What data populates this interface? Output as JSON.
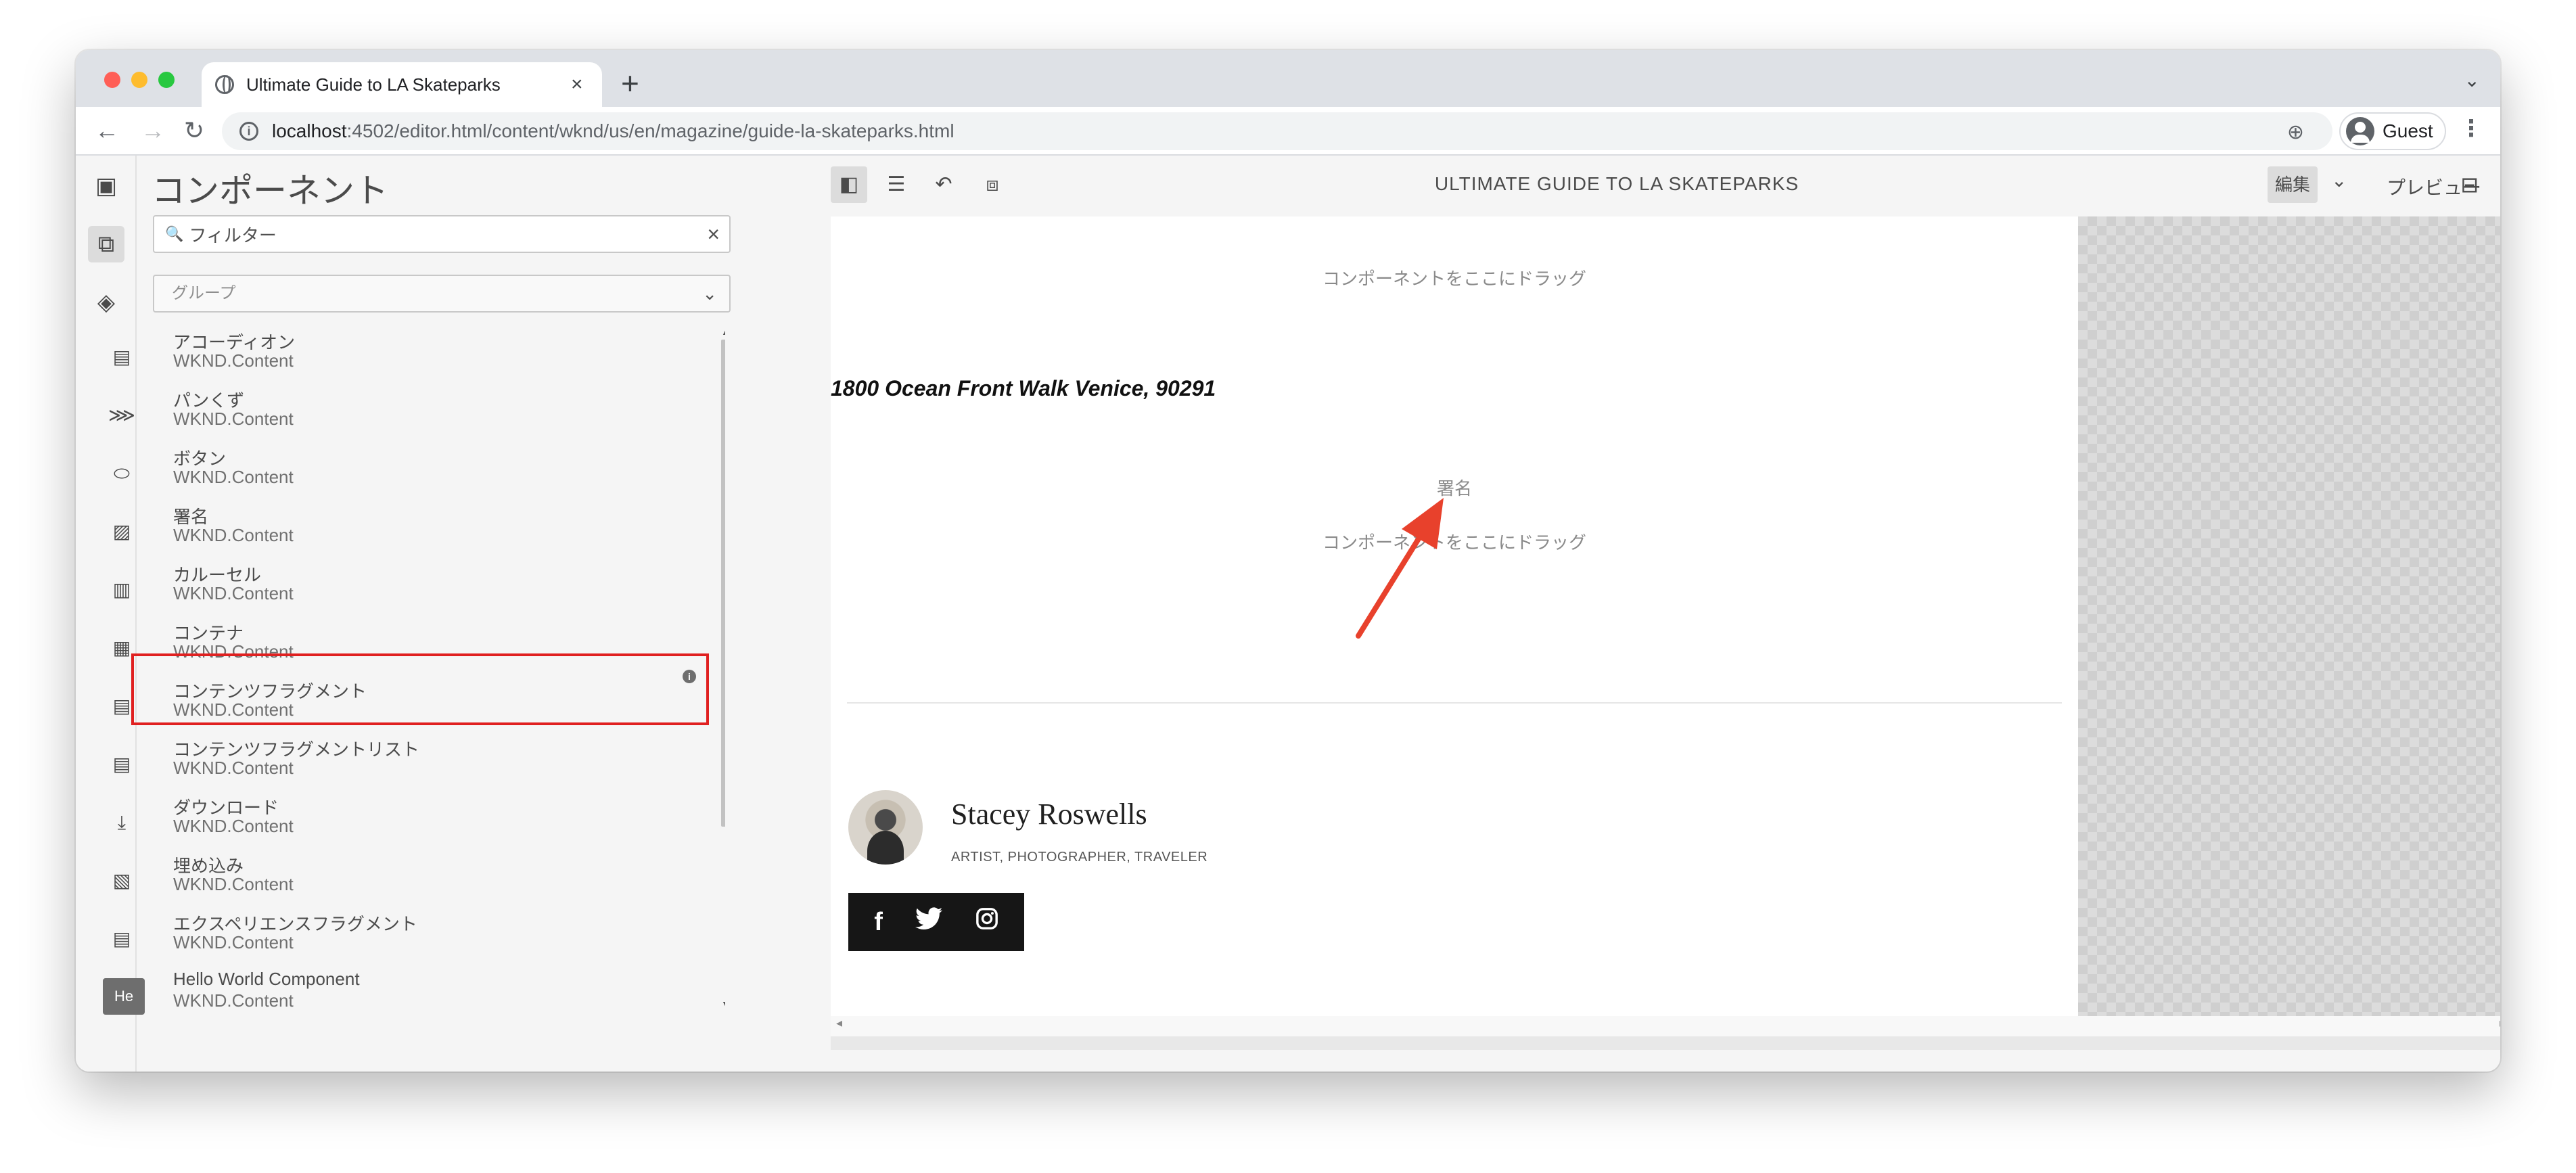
{
  "browser": {
    "tab_title": "Ultimate Guide to LA Skateparks",
    "tab_close": "×",
    "new_tab": "+",
    "url_host": "localhost",
    "url_rest": ":4502/editor.html/content/wknd/us/en/magazine/guide-la-skateparks.html",
    "profile_name": "Guest"
  },
  "panel": {
    "title": "コンポーネント",
    "filter_placeholder": "フィルター",
    "group_placeholder": "グループ",
    "components": [
      {
        "name": "アコーディオン",
        "group": "WKND.Content",
        "icon": "accordion-icon"
      },
      {
        "name": "パンくず",
        "group": "WKND.Content",
        "icon": "breadcrumb-icon"
      },
      {
        "name": "ボタン",
        "group": "WKND.Content",
        "icon": "button-icon"
      },
      {
        "name": "署名",
        "group": "WKND.Content",
        "icon": "image-icon"
      },
      {
        "name": "カルーセル",
        "group": "WKND.Content",
        "icon": "carousel-icon"
      },
      {
        "name": "コンテナ",
        "group": "WKND.Content",
        "icon": "container-icon"
      },
      {
        "name": "コンテンツフラグメント",
        "group": "WKND.Content",
        "icon": "content-fragment-icon"
      },
      {
        "name": "コンテンツフラグメントリスト",
        "group": "WKND.Content",
        "icon": "content-fragment-list-icon"
      },
      {
        "name": "ダウンロード",
        "group": "WKND.Content",
        "icon": "download-icon"
      },
      {
        "name": "埋め込み",
        "group": "WKND.Content",
        "icon": "embed-icon"
      },
      {
        "name": "エクスペリエンスフラグメント",
        "group": "WKND.Content",
        "icon": "experience-fragment-icon"
      },
      {
        "name": "Hello World Component",
        "group": "WKND.Content",
        "icon": "hello-world-badge",
        "badge": "He"
      }
    ]
  },
  "editor": {
    "page_title": "ULTIMATE GUIDE TO LA SKATEPARKS",
    "edit_label": "編集",
    "preview_label": "プレビュー"
  },
  "page": {
    "drop_hint_1": "コンポーネントをここにドラッグ",
    "address": "1800 Ocean Front Walk Venice, 90291",
    "signature_label": "署名",
    "drop_hint_2": "コンポーネントをここにドラッグ",
    "author_name": "Stacey Roswells",
    "author_role": "ARTIST, PHOTOGRAPHER, TRAVELER",
    "social": [
      "f",
      "twitter",
      "instagram"
    ]
  },
  "colors": {
    "highlight": "#e02020",
    "arrow": "#e8412c"
  }
}
